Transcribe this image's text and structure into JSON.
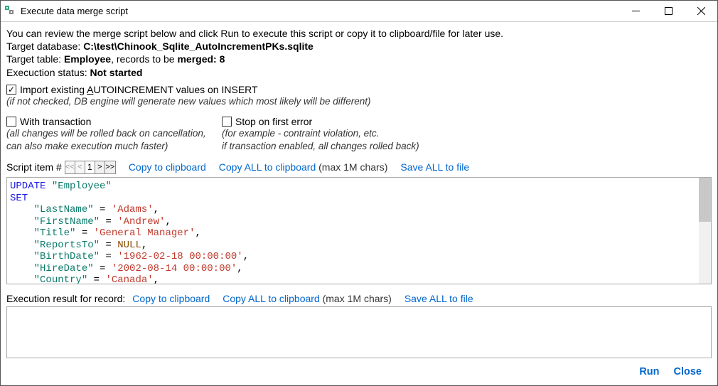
{
  "title": "Execute data merge script",
  "intro": "You can review the merge script below and click Run to execute this script or copy it to clipboard/file for later use.",
  "target_db_label": "Target database: ",
  "target_db_value": "C:\\test\\Chinook_Sqlite_AutoIncrementPKs.sqlite",
  "target_table_label": "Target table: ",
  "target_table_value": "Employee",
  "records_label": ", records to be ",
  "records_type": "merged: 8",
  "exec_status_label": "Execuction status: ",
  "exec_status_value": "Not started",
  "chk_import_label_pre": "Import existing ",
  "chk_import_label_u": "A",
  "chk_import_label_post": "UTOINCREMENT values on INSERT",
  "chk_import_hint": "(if not checked, DB engine will generate new values which most likely will be different)",
  "chk_transaction_label": "With transaction",
  "chk_transaction_hint1": "(all changes will be rolled back on cancellation,",
  "chk_transaction_hint2": " can also make execution much faster)",
  "chk_stop_label": "Stop on first error",
  "chk_stop_hint1": "(for example - contraint violation, etc.",
  "chk_stop_hint2": " if transaction enabled, all changes rolled back)",
  "script_item_label": "Script item #",
  "pager_value": "1",
  "link_copy_clip": "Copy to clipboard",
  "link_copy_all_clip": "Copy ALL to clipboard",
  "copy_all_note": " (max 1M chars)",
  "link_save_all": "Save ALL to file",
  "sql_tokens": [
    {
      "t": "UPDATE",
      "c": "kw"
    },
    {
      "t": " ",
      "c": ""
    },
    {
      "t": "\"Employee\"",
      "c": "id"
    },
    {
      "t": "\n",
      "c": ""
    },
    {
      "t": "SET",
      "c": "kw"
    },
    {
      "t": "\n",
      "c": ""
    },
    {
      "t": "    ",
      "c": ""
    },
    {
      "t": "\"LastName\"",
      "c": "id"
    },
    {
      "t": " = ",
      "c": ""
    },
    {
      "t": "'Adams'",
      "c": "str"
    },
    {
      "t": ",",
      "c": ""
    },
    {
      "t": "\n",
      "c": ""
    },
    {
      "t": "    ",
      "c": ""
    },
    {
      "t": "\"FirstName\"",
      "c": "id"
    },
    {
      "t": " = ",
      "c": ""
    },
    {
      "t": "'Andrew'",
      "c": "str"
    },
    {
      "t": ",",
      "c": ""
    },
    {
      "t": "\n",
      "c": ""
    },
    {
      "t": "    ",
      "c": ""
    },
    {
      "t": "\"Title\"",
      "c": "id"
    },
    {
      "t": " = ",
      "c": ""
    },
    {
      "t": "'General Manager'",
      "c": "str"
    },
    {
      "t": ",",
      "c": ""
    },
    {
      "t": "\n",
      "c": ""
    },
    {
      "t": "    ",
      "c": ""
    },
    {
      "t": "\"ReportsTo\"",
      "c": "id"
    },
    {
      "t": " = ",
      "c": ""
    },
    {
      "t": "NULL",
      "c": "nullkw"
    },
    {
      "t": ",",
      "c": ""
    },
    {
      "t": "\n",
      "c": ""
    },
    {
      "t": "    ",
      "c": ""
    },
    {
      "t": "\"BirthDate\"",
      "c": "id"
    },
    {
      "t": " = ",
      "c": ""
    },
    {
      "t": "'1962-02-18 00:00:00'",
      "c": "str"
    },
    {
      "t": ",",
      "c": ""
    },
    {
      "t": "\n",
      "c": ""
    },
    {
      "t": "    ",
      "c": ""
    },
    {
      "t": "\"HireDate\"",
      "c": "id"
    },
    {
      "t": " = ",
      "c": ""
    },
    {
      "t": "'2002-08-14 00:00:00'",
      "c": "str"
    },
    {
      "t": ",",
      "c": ""
    },
    {
      "t": "\n",
      "c": ""
    },
    {
      "t": "    ",
      "c": ""
    },
    {
      "t": "\"Country\"",
      "c": "id"
    },
    {
      "t": " = ",
      "c": ""
    },
    {
      "t": "'Canada'",
      "c": "str"
    },
    {
      "t": ",",
      "c": ""
    }
  ],
  "result_label": "Execution result for record:",
  "btn_run": "Run",
  "btn_close": "Close"
}
